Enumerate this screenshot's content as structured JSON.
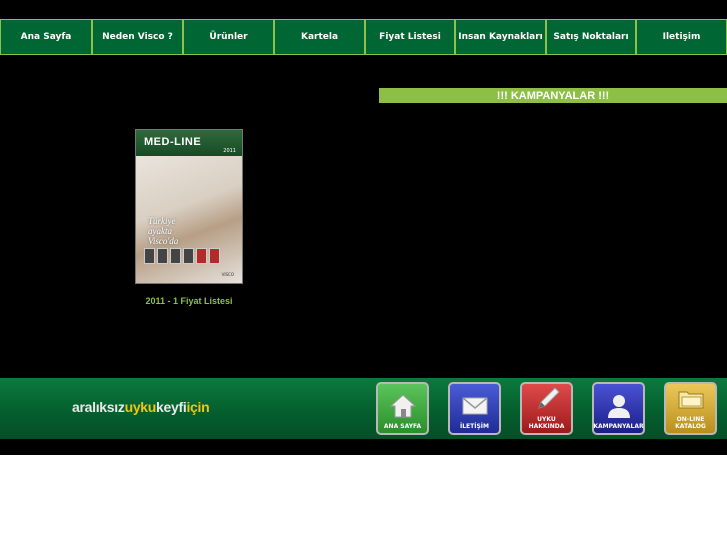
{
  "nav": {
    "items": [
      {
        "label": "Ana Sayfa"
      },
      {
        "label": "Neden Visco ?"
      },
      {
        "label": "Ürünler"
      },
      {
        "label": "Kartela"
      },
      {
        "label": "Fiyat Listesi"
      },
      {
        "label": "Insan Kaynakları"
      },
      {
        "label": "Satış Noktaları"
      },
      {
        "label": "Iletişim"
      }
    ]
  },
  "campaign": {
    "title": "!!! KAMPANYALAR !!!"
  },
  "catalog": {
    "brand": "MED-LINE",
    "year": "2011",
    "slogan_line1": "Türkiye",
    "slogan_line2": "ayakta",
    "slogan_line3": "Visco'da",
    "footer_brand": "VISCO",
    "link_label": "2011 - 1 Fiyat Listesi"
  },
  "footer": {
    "slogan_part1": "aralıksız",
    "slogan_part2": "uyku",
    "slogan_part3": "keyfi",
    "slogan_part4": "için",
    "buttons": [
      {
        "label": "ANA SAYFA",
        "icon": "home-icon",
        "color": "#3aa83a"
      },
      {
        "label": "İLETİŞİM",
        "icon": "mail-icon",
        "color": "#2f3fb4"
      },
      {
        "label": "UYKU HAKKINDA",
        "icon": "pen-icon",
        "color": "#c62828"
      },
      {
        "label": "KAMPANYALAR",
        "icon": "person-icon",
        "color": "#2c34a8"
      },
      {
        "label": "ON-LINE KATALOG",
        "icon": "folder-icon",
        "color": "#d4b03a"
      }
    ]
  },
  "colors": {
    "accent_green": "#8dbf45",
    "nav_green": "#006634"
  }
}
